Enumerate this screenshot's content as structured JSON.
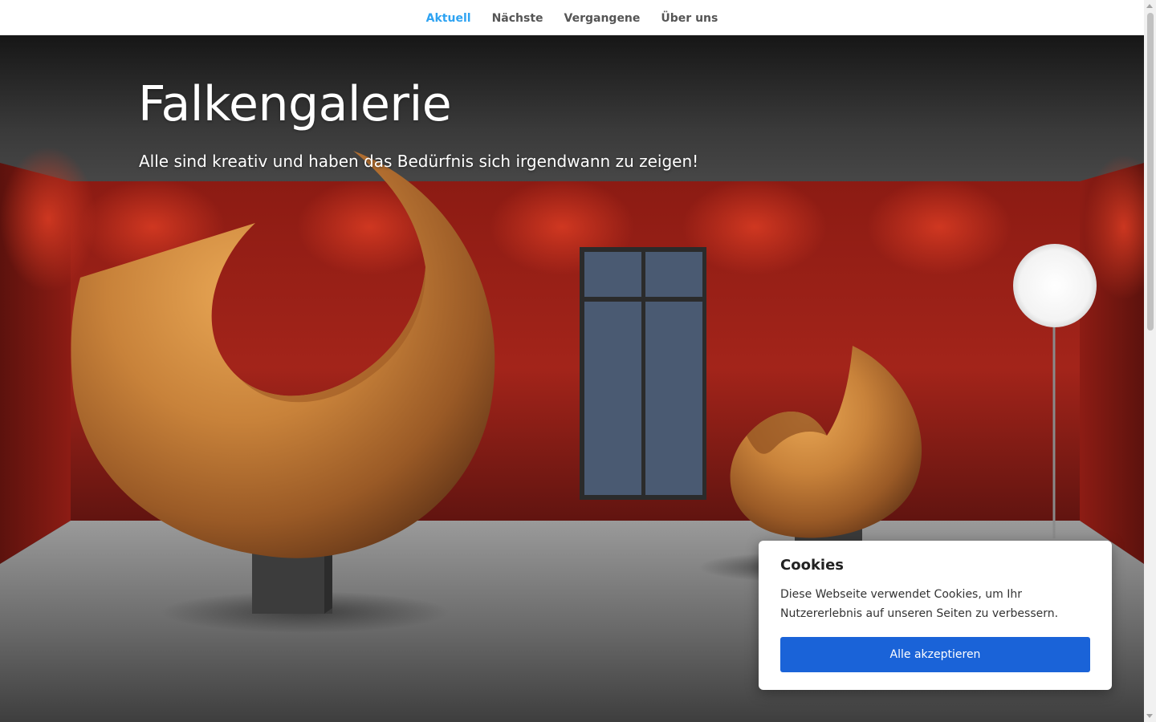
{
  "nav": {
    "items": [
      {
        "label": "Aktuell",
        "active": true
      },
      {
        "label": "Nächste",
        "active": false
      },
      {
        "label": "Vergangene",
        "active": false
      },
      {
        "label": "Über uns",
        "active": false
      }
    ]
  },
  "hero": {
    "title": "Falkengalerie",
    "subtitle": "Alle sind kreativ und haben das Bedürfnis sich irgendwann zu zeigen!"
  },
  "cookie": {
    "title": "Cookies",
    "text": "Diese Webseite verwendet Cookies, um Ihr Nutzererlebnis auf unseren Seiten zu verbessern.",
    "accept_label": "Alle akzeptieren"
  },
  "colors": {
    "nav_active": "#2ea3f2",
    "nav_text": "#555555",
    "wall": "#9c1f16",
    "button": "#1a63d8"
  }
}
